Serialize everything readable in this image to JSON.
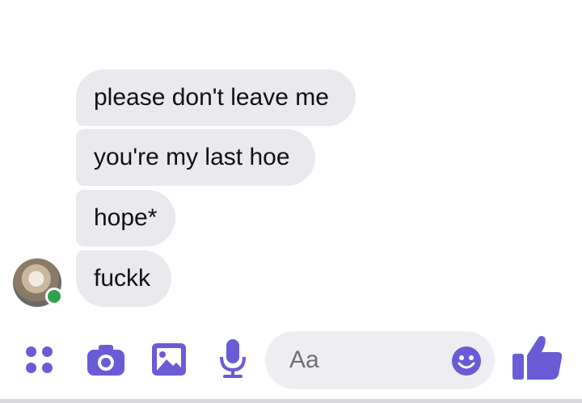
{
  "messages": [
    {
      "text": "please don't leave me"
    },
    {
      "text": "you're my last hoe"
    },
    {
      "text": "hope*"
    },
    {
      "text": "fuckk"
    }
  ],
  "composer": {
    "placeholder": "Aa",
    "icons": [
      "menu-dots-icon",
      "camera-icon",
      "image-icon",
      "microphone-icon",
      "emoji-icon",
      "thumbs-up-icon"
    ]
  },
  "colors": {
    "bubble": "#e9e9ee",
    "accent": "#6b5bd6",
    "presence": "#31a24c"
  }
}
